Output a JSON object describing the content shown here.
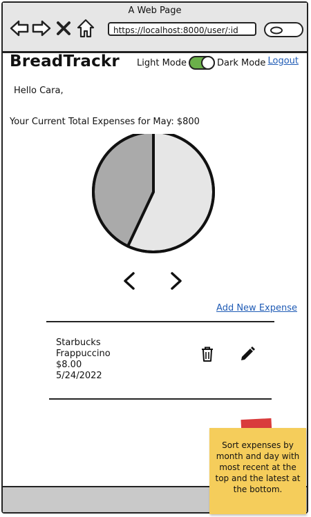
{
  "browser": {
    "title": "A Web Page",
    "url": "https://localhost:8000/user/:id"
  },
  "header": {
    "brand": "BreadTrackr",
    "light_mode_label": "Light Mode",
    "dark_mode_label": "Dark Mode",
    "logout_label": "Logout"
  },
  "greeting": "Hello Cara,",
  "summary": "Your Current Total Expenses for May: $800",
  "chart_data": {
    "type": "pie",
    "values": [
      57,
      43
    ],
    "colors": [
      "#e6e6e6",
      "#aaaaaa"
    ]
  },
  "actions": {
    "add_expense_label": "Add New Expense"
  },
  "expenses": [
    {
      "merchant": "Starbucks",
      "item": "Frappuccino",
      "amount": "$8.00",
      "date": "5/24/2022"
    }
  ],
  "note": {
    "text": "Sort expenses by month and day with most recent at the top and the latest at the bottom."
  }
}
